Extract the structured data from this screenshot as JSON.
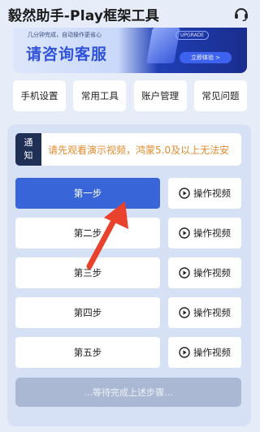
{
  "header": {
    "title": "毅然助手-Play框架工具",
    "support_icon": "headset-icon"
  },
  "banner": {
    "small_text": "几分钟完成，自动操作更省心",
    "headline": "请咨询客服",
    "tag": "UPGRADE",
    "cta": "立即体验 >"
  },
  "tools": [
    {
      "label": "手机设置"
    },
    {
      "label": "常用工具"
    },
    {
      "label": "账户管理"
    },
    {
      "label": "常见问题"
    }
  ],
  "notice": {
    "tag_line1": "通",
    "tag_line2": "知",
    "message": "请先观看演示视频，鸿蒙5.0及以上无法安"
  },
  "steps": [
    {
      "label": "第一步",
      "video_label": "操作视频"
    },
    {
      "label": "第二步",
      "video_label": "操作视频"
    },
    {
      "label": "第三步",
      "video_label": "操作视频"
    },
    {
      "label": "第四步",
      "video_label": "操作视频"
    },
    {
      "label": "第五步",
      "video_label": "操作视频"
    }
  ],
  "wait_button": "...等待完成上述步骤...",
  "colors": {
    "accent": "#3866d8",
    "notice_text": "#e48b2e",
    "arrow": "#e8412c"
  }
}
